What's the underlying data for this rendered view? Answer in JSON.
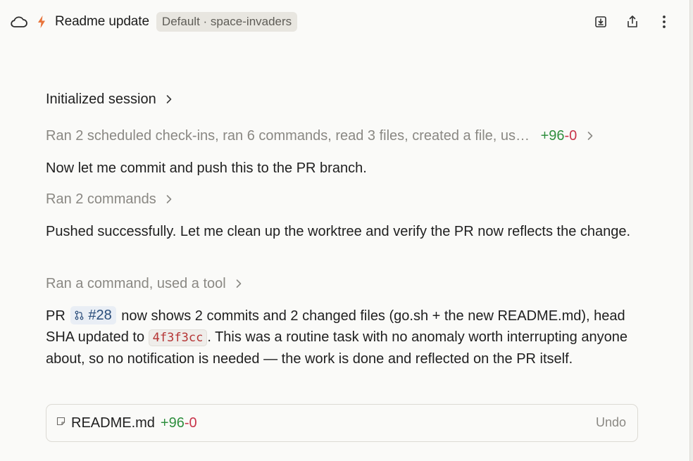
{
  "header": {
    "title": "Readme update",
    "badge": "Default · space-invaders",
    "icons": [
      "cloud-icon",
      "bolt-icon",
      "download-icon",
      "share-icon",
      "more-vertical-icon"
    ]
  },
  "timeline": {
    "initialized": "Initialized session",
    "summary1": "Ran 2 scheduled check-ins, ran 6 commands, read 3 files, created a file, us…",
    "summary1_add": "+96",
    "summary1_del": "-0",
    "msg1": "Now let me commit and push this to the PR branch.",
    "summary2": "Ran 2 commands",
    "msg2": "Pushed successfully. Let me clean up the worktree and verify the PR now reflects the change.",
    "summary3": "Ran a command, used a tool",
    "msg3_part1": "PR",
    "pr_number": "#28",
    "msg3_part2": "now shows 2 commits and 2 changed files (go.sh + the new README.md), head SHA updated to",
    "sha": "4f3f3cc",
    "msg3_part3": ". This was a routine task with no anomaly worth interrupting anyone about, so no notification is needed — the work is done and reflected on the PR itself."
  },
  "file_card": {
    "name": "README.md",
    "add": "+96",
    "del": "-0",
    "undo": "Undo"
  },
  "colors": {
    "accent_add": "#2f8f3f",
    "accent_del": "#c8344a",
    "bolt": "#e8733a"
  }
}
